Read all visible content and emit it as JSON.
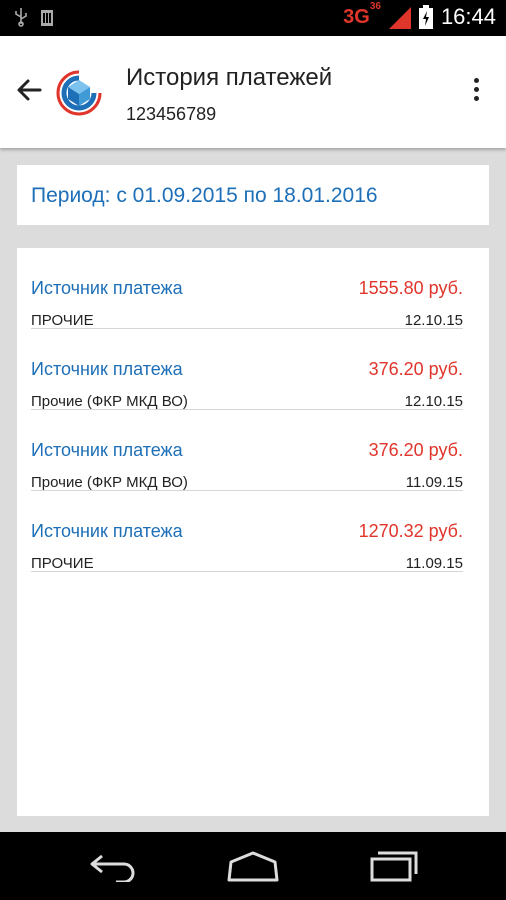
{
  "status_bar": {
    "network": "3G",
    "network_super": "36",
    "time": "16:44"
  },
  "header": {
    "title": "История платежей",
    "account": "123456789"
  },
  "period": {
    "text": "Период: с 01.09.2015 по 18.01.2016"
  },
  "payments": [
    {
      "source": "Источник платежа",
      "amount": "1555.80 руб.",
      "category": "ПРОЧИЕ",
      "date": "12.10.15"
    },
    {
      "source": "Источник платежа",
      "amount": "376.20 руб.",
      "category": "Прочие (ФКР МКД ВО)",
      "date": "12.10.15"
    },
    {
      "source": "Источник платежа",
      "amount": "376.20 руб.",
      "category": "Прочие (ФКР МКД ВО)",
      "date": "11.09.15"
    },
    {
      "source": "Источник платежа",
      "amount": "1270.32 руб.",
      "category": "ПРОЧИЕ",
      "date": "11.09.15"
    }
  ],
  "colors": {
    "link_blue": "#1d6fb8",
    "amount_red": "#e0352b",
    "background": "#dcdcdc"
  },
  "icons": {
    "status": [
      "usb-icon",
      "sim-icon",
      "signal-icon",
      "battery-icon"
    ],
    "header": [
      "back-arrow-icon",
      "app-logo-icon",
      "more-vert-icon"
    ],
    "nav": [
      "back-icon",
      "home-icon",
      "recents-icon"
    ]
  }
}
